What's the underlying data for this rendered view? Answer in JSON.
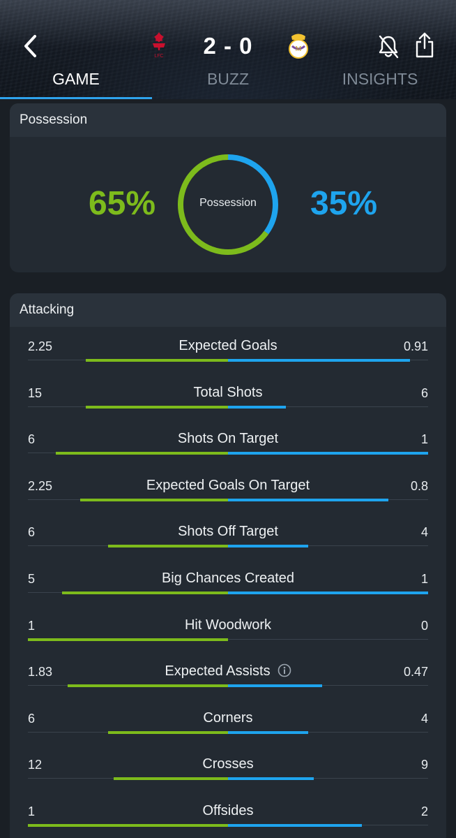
{
  "header": {
    "score": "2 - 0",
    "home_badge_text": "LFC",
    "icons": {
      "back": "back-chevron-icon",
      "bell": "bell-muted-icon",
      "share": "share-icon"
    }
  },
  "tabs": [
    {
      "label": "GAME",
      "active": true
    },
    {
      "label": "BUZZ",
      "active": false
    },
    {
      "label": "INSIGHTS",
      "active": false
    }
  ],
  "colors": {
    "home": "#7dbb1c",
    "away": "#1ea4ee",
    "accent": "#2ea3ec"
  },
  "possession": {
    "title": "Possession",
    "home": "65%",
    "away": "35%",
    "home_value": 65,
    "away_value": 35,
    "center_label": "Possession"
  },
  "attacking": {
    "title": "Attacking",
    "stats": [
      {
        "label": "Expected Goals",
        "home": "2.25",
        "away": "0.91",
        "home_share": 0.71,
        "away_share": 0.91
      },
      {
        "label": "Total Shots",
        "home": "15",
        "away": "6",
        "home_share": 0.71,
        "away_share": 0.29
      },
      {
        "label": "Shots On Target",
        "home": "6",
        "away": "1",
        "home_share": 0.86,
        "away_share": 1.0
      },
      {
        "label": "Expected Goals On Target",
        "home": "2.25",
        "away": "0.8",
        "home_share": 0.74,
        "away_share": 0.8
      },
      {
        "label": "Shots Off Target",
        "home": "6",
        "away": "4",
        "home_share": 0.6,
        "away_share": 0.4
      },
      {
        "label": "Big Chances Created",
        "home": "5",
        "away": "1",
        "home_share": 0.83,
        "away_share": 1.0
      },
      {
        "label": "Hit Woodwork",
        "home": "1",
        "away": "0",
        "home_share": 1.0,
        "away_share": 0.0
      },
      {
        "label": "Expected Assists",
        "home": "1.83",
        "away": "0.47",
        "home_share": 0.8,
        "away_share": 0.47,
        "info": true
      },
      {
        "label": "Corners",
        "home": "6",
        "away": "4",
        "home_share": 0.6,
        "away_share": 0.4
      },
      {
        "label": "Crosses",
        "home": "12",
        "away": "9",
        "home_share": 0.57,
        "away_share": 0.43
      },
      {
        "label": "Offsides",
        "home": "1",
        "away": "2",
        "home_share": 1.0,
        "away_share": 0.67
      }
    ]
  }
}
